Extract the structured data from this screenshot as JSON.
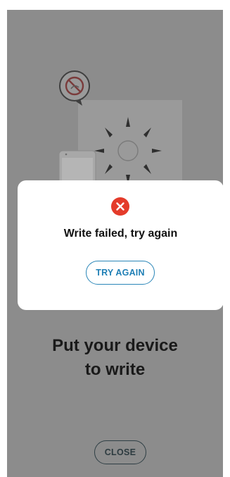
{
  "colors": {
    "overlay": "#8c8c8c",
    "dialog_background": "#ffffff",
    "error_icon": "#e43b2a",
    "primary_button": "#2a86b8",
    "close_button": "#2f3f45"
  },
  "illustration": {
    "icons": [
      "no-signal-icon",
      "nfc-reader-icon",
      "phone-icon"
    ]
  },
  "main": {
    "prompt_line1": "Put your device",
    "prompt_line2": "to write",
    "close_label": "CLOSE"
  },
  "dialog": {
    "icon": "error-x-icon",
    "message": "Write failed, try again",
    "try_again_label": "TRY AGAIN"
  }
}
